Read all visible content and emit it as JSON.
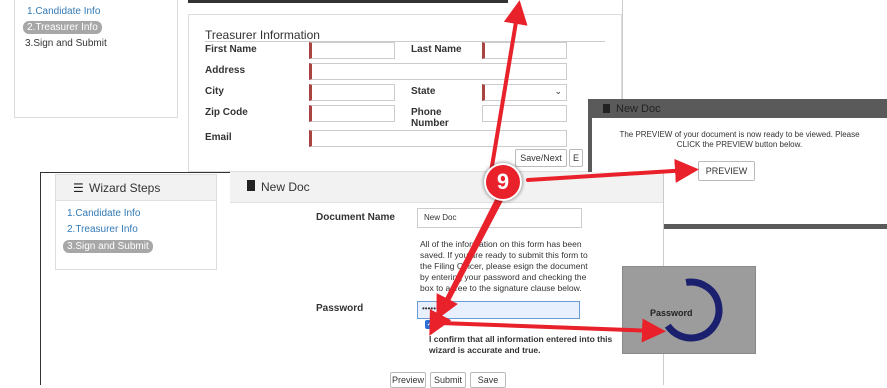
{
  "back_screen": {
    "steps": [
      "1.Candidate Info",
      "2.Treasurer Info",
      "3.Sign and Submit"
    ],
    "section_title": "Treasurer Information",
    "fields": {
      "first_name": "First Name",
      "last_name": "Last Name",
      "address": "Address",
      "city": "City",
      "state": "State",
      "zip_code": "Zip Code",
      "phone_number": "Phone Number",
      "email": "Email"
    },
    "save_next_button": "Save/Next",
    "partial_button": "E"
  },
  "front_screen": {
    "sidebar_title": "Wizard Steps",
    "steps": [
      "1.Candidate Info",
      "2.Treasurer Info",
      "3.Sign and Submit"
    ],
    "doc_title": "New Doc",
    "document_name_label": "Document Name",
    "document_name_value": "New Doc",
    "info_text": "All of the information on this form has been saved. If you are ready to submit this form to the Filing Officer, please esign the document by entering your password and checking the box to agree to the signature clause below.",
    "password_label": "Password",
    "password_value": "•••••",
    "confirm_text": "I confirm that all information entered into this wizard is accurate and true.",
    "buttons": [
      "Preview",
      "Submit",
      "Save"
    ]
  },
  "preview_popup": {
    "partial_title": "New Doc",
    "message": "The PREVIEW of your document is now ready to be viewed. Please CLICK the PREVIEW button below.",
    "button": "PREVIEW"
  },
  "spinner": {
    "label": "Password"
  },
  "callout": {
    "number": "9",
    "color": "#e8212a"
  }
}
